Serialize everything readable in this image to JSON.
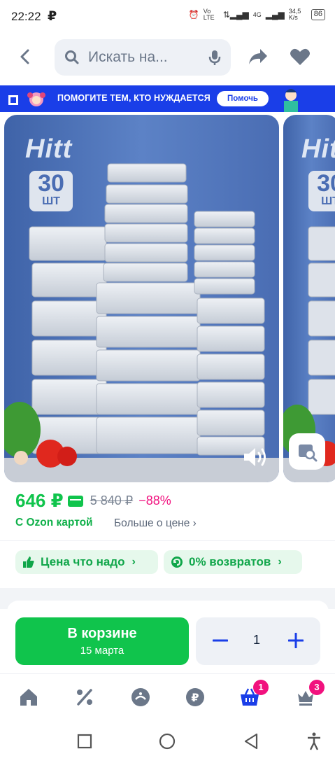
{
  "status": {
    "time": "22:22",
    "volte": "Vo LTE",
    "net": "4G",
    "speed": "34,5 K/s",
    "battery": "86"
  },
  "search": {
    "placeholder": "Искать на..."
  },
  "banner": {
    "text": "ПОМОГИТЕ ТЕМ, КТО НУЖДАЕТСЯ",
    "button": "Помочь"
  },
  "gallery": {
    "brand": "Hitt",
    "count": "30",
    "unit": "ШТ"
  },
  "price": {
    "current": "646 ₽",
    "old": "5 840 ₽",
    "discount": "−88%",
    "ozon_card": "С Ozon картой",
    "more": "Больше о цене ›"
  },
  "chips": [
    {
      "label": "Цена что надо"
    },
    {
      "label": "0% возвратов"
    }
  ],
  "cart": {
    "title": "В корзине",
    "date": "15 марта",
    "qty": "1"
  },
  "nav": {
    "cart_badge": "1",
    "profile_badge": "3"
  },
  "colors": {
    "accent": "#10c44c",
    "discount": "#f1117e",
    "banner": "#1a3ee8"
  }
}
